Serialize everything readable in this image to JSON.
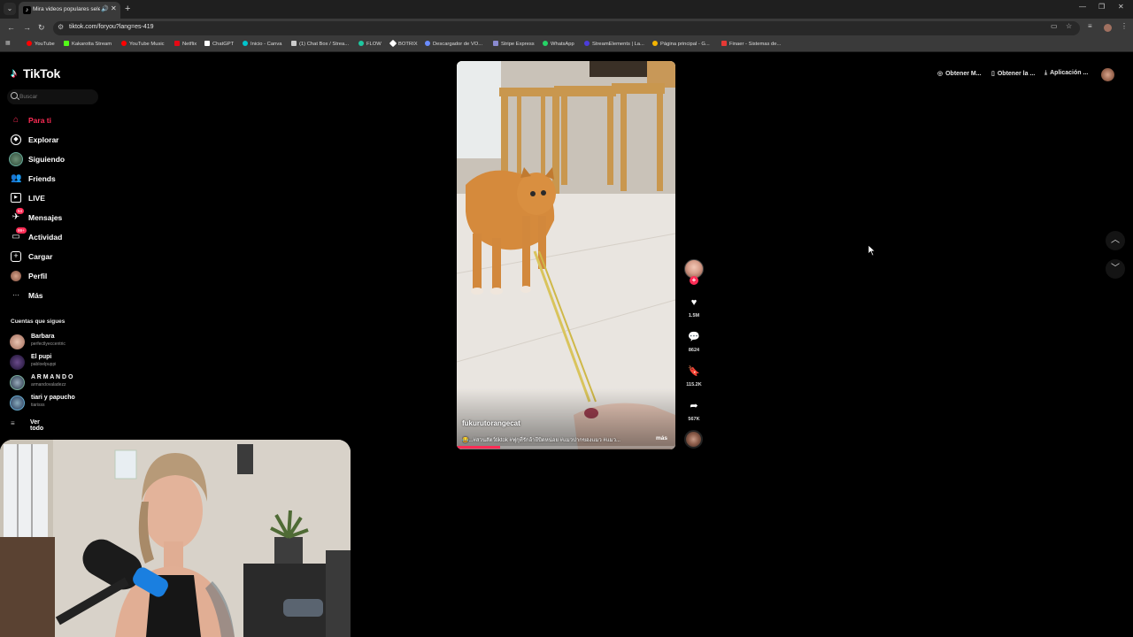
{
  "browser": {
    "tab_title": "Mira videos populares selec",
    "url": "tiktok.com/foryou?lang=es-419",
    "bookmarks": [
      "YouTube",
      "Kakarotta Stream",
      "YouTube Music",
      "Netflix",
      "ChatGPT",
      "Inicio - Canva",
      "(1) Chat Box / Strea...",
      "FLOW",
      "BOTRIX",
      "Descargador de VO...",
      "Stripe Express",
      "WhatsApp",
      "StreamElements | La...",
      "Página principal - G...",
      "Finaer - Sistemas de..."
    ]
  },
  "sidebar": {
    "logo": "TikTok",
    "search_placeholder": "Buscar",
    "nav": [
      {
        "label": "Para ti",
        "icon": "home-icon",
        "active": true
      },
      {
        "label": "Explorar",
        "icon": "compass-icon"
      },
      {
        "label": "Siguiendo",
        "icon": "following-icon"
      },
      {
        "label": "Friends",
        "icon": "friends-icon"
      },
      {
        "label": "LIVE",
        "icon": "live-icon"
      },
      {
        "label": "Mensajes",
        "icon": "messages-icon",
        "badge": "54"
      },
      {
        "label": "Actividad",
        "icon": "activity-icon",
        "badge": "99+"
      },
      {
        "label": "Cargar",
        "icon": "upload-icon"
      },
      {
        "label": "Perfil",
        "icon": "profile-icon"
      },
      {
        "label": "Más",
        "icon": "more-icon"
      }
    ],
    "following_title": "Cuentas que sigues",
    "accounts": [
      {
        "name": "Barbara",
        "user": "perfectlyeccentric"
      },
      {
        "name": "El pupi",
        "user": "pabloelpuppi"
      },
      {
        "name": "A R M A N D O",
        "user": "armandovaladezz"
      },
      {
        "name": "tiari y papucho",
        "user": "tiarisss"
      }
    ],
    "see_all": "Ver todo"
  },
  "video": {
    "author": "fukurutorangecat",
    "description": "😂...#สวนสัตว์tiktok #ฟุกุที่รักอ้ายีบิดหน่อย #แมวปากของแมว #แมว...",
    "more": "más",
    "progress": 0.2,
    "likes": "1.5M",
    "comments": "8624",
    "saves": "115.2K",
    "shares": "567K"
  },
  "top_actions": [
    "Obtener M...",
    "Obtener la ...",
    "Aplicación ..."
  ]
}
